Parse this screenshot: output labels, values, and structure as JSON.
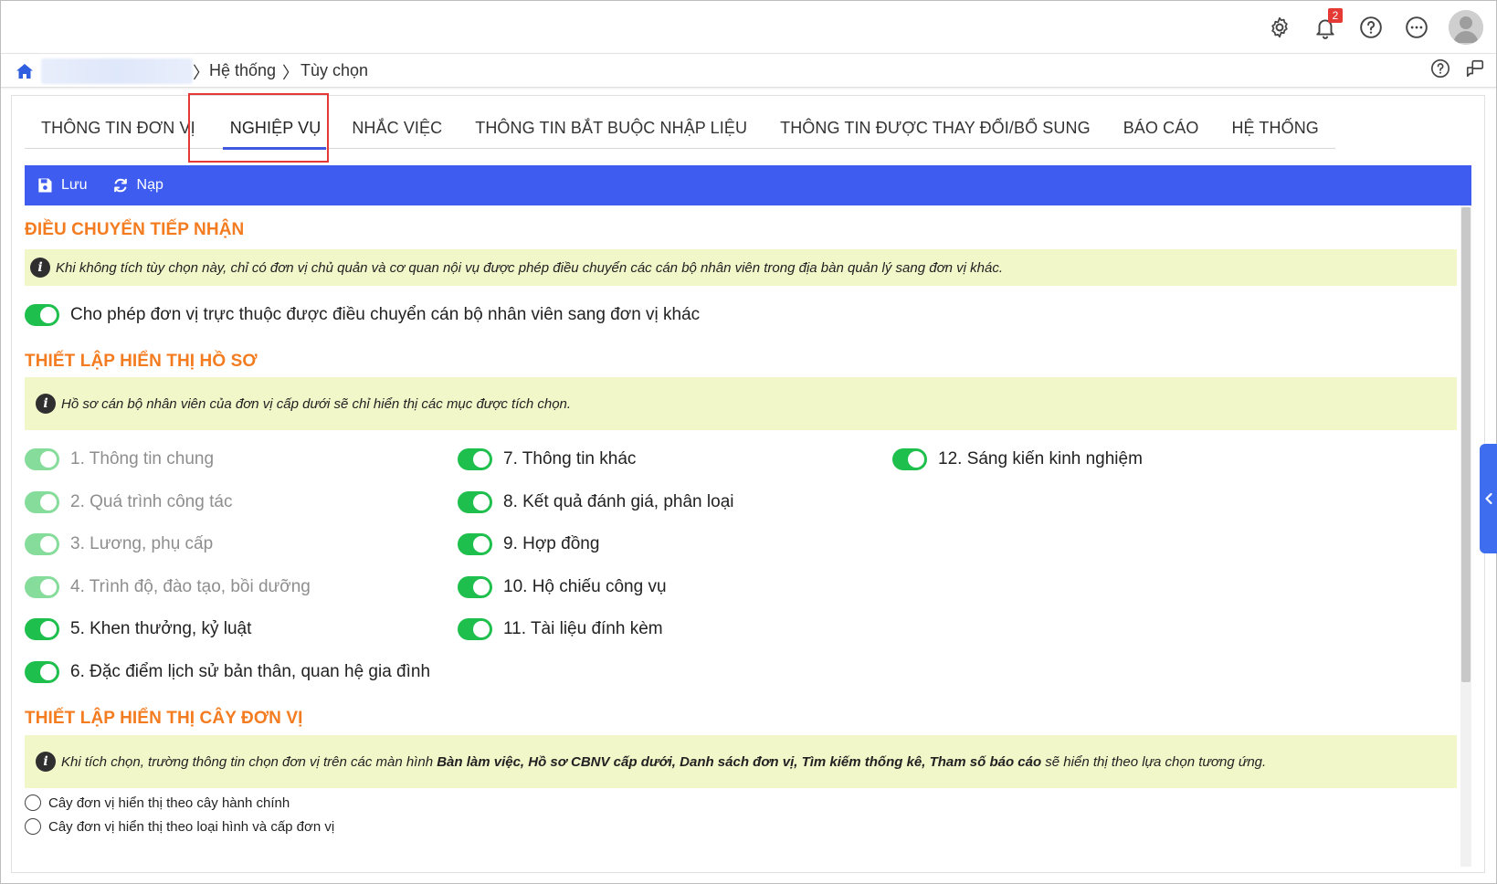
{
  "topbar": {
    "notification_count": "2",
    "icons": [
      "gear-icon",
      "bell-icon",
      "help-icon",
      "more-icon",
      "avatar"
    ]
  },
  "breadcrumb": {
    "items": [
      "Hệ thống",
      "Tùy chọn"
    ],
    "separator": "〉"
  },
  "tabs": [
    {
      "label": "THÔNG TIN ĐƠN VỊ"
    },
    {
      "label": "NGHIỆP VỤ",
      "active": true
    },
    {
      "label": "NHẮC VIỆC"
    },
    {
      "label": "THÔNG TIN BẮT BUỘC NHẬP LIỆU"
    },
    {
      "label": "THÔNG TIN ĐƯỢC THAY ĐỔI/BỔ SUNG"
    },
    {
      "label": "BÁO CÁO"
    },
    {
      "label": "HỆ THỐNG"
    }
  ],
  "toolbar": {
    "save_label": "Lưu",
    "reload_label": "Nạp",
    "color": "#3e5df0"
  },
  "sections": {
    "transfer": {
      "title": "ĐIỀU CHUYỂN TIẾP NHẬN",
      "note": "Khi không tích tùy chọn này, chỉ có đơn vị chủ quản và cơ quan nội vụ được phép điều chuyển các cán bộ nhân viên trong địa bàn quản lý sang đơn vị khác.",
      "toggle_label": "Cho phép đơn vị trực thuộc được điều chuyển cán bộ nhân viên sang đơn vị khác"
    },
    "profile_display": {
      "title": "THIẾT LẬP HIỂN THỊ HỒ SƠ",
      "note": "Hồ sơ cán bộ nhân viên của đơn vị cấp dưới sẽ chỉ hiển thị các mục được tích chọn.",
      "items": [
        {
          "label": "1. Thông tin chung",
          "disabled": true
        },
        {
          "label": "2. Quá trình công tác",
          "disabled": true
        },
        {
          "label": "3. Lương, phụ cấp",
          "disabled": true
        },
        {
          "label": "4. Trình độ, đào tạo, bồi dưỡng",
          "disabled": true
        },
        {
          "label": "5. Khen thưởng, kỷ luật",
          "disabled": false
        },
        {
          "label": "6. Đặc điểm lịch sử bản thân, quan hệ gia đình",
          "disabled": false
        },
        {
          "label": "7. Thông tin khác",
          "disabled": false
        },
        {
          "label": "8. Kết quả đánh giá, phân loại",
          "disabled": false
        },
        {
          "label": "9. Hợp đồng",
          "disabled": false
        },
        {
          "label": "10. Hộ chiếu công vụ",
          "disabled": false
        },
        {
          "label": "11. Tài liệu đính kèm",
          "disabled": false
        },
        {
          "label": "12. Sáng kiến kinh nghiệm",
          "disabled": false
        }
      ]
    },
    "unit_tree": {
      "title": "THIẾT LẬP HIỂN THỊ CÂY ĐƠN VỊ",
      "note_prefix": "Khi tích chọn, trường thông tin chọn đơn vị trên các màn hình ",
      "note_bold": "Bàn làm việc, Hồ sơ CBNV cấp dưới, Danh sách đơn vị, Tìm kiếm thống kê, Tham số báo cáo",
      "note_suffix": " sẽ hiển thị theo lựa chọn tương ứng.",
      "options": [
        "Cây đơn vị hiển thị theo cây hành chính",
        "Cây đơn vị hiển thị theo loại hình và cấp đơn vị"
      ]
    }
  },
  "colors": {
    "accent": "#3e5df0",
    "section_title": "#f47c20",
    "note_bg": "#f1f7c9",
    "toggle_on": "#1fbf4d",
    "toggle_disabled": "#86dc9a",
    "highlight_box": "#e53935"
  }
}
